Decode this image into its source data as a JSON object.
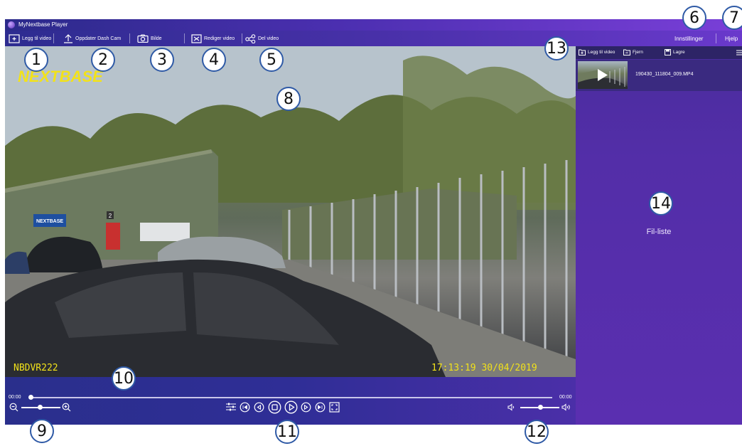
{
  "app": {
    "title": "MyNextbase Player"
  },
  "toolbar": {
    "add_video": "Legg til video",
    "update_dashcam": "Oppdater Dash Cam",
    "photo": "Bilde",
    "edit_video": "Rediger video",
    "share_video": "Del video",
    "settings": "Innstillinger",
    "help": "Hjelp"
  },
  "video": {
    "brand_overlay": "NEXTBASE",
    "device_overlay": "NBDVR222",
    "timestamp_overlay": "17:13:19 30/04/2019",
    "building_number": "2",
    "sign_text": "NEXTBASE"
  },
  "controls": {
    "time_start": "00:00",
    "time_end": "00:00",
    "zoom_level": 0.45,
    "volume_level": 0.45,
    "seek_progress": 0.0
  },
  "sidebar": {
    "add_video": "Legg til video",
    "remove": "Fjern",
    "save": "Lagre",
    "files": [
      {
        "name": "190430_111804_009.MP4"
      }
    ],
    "empty_label": "Fil-liste"
  },
  "callouts": [
    "1",
    "2",
    "3",
    "4",
    "5",
    "6",
    "7",
    "8",
    "9",
    "10",
    "11",
    "12",
    "13",
    "14"
  ],
  "colors": {
    "accent": "#4b2fb0",
    "sidebar": "#5a2fb0",
    "overlay_yellow": "#f2e21a",
    "callout_border": "#2f5aa6"
  }
}
